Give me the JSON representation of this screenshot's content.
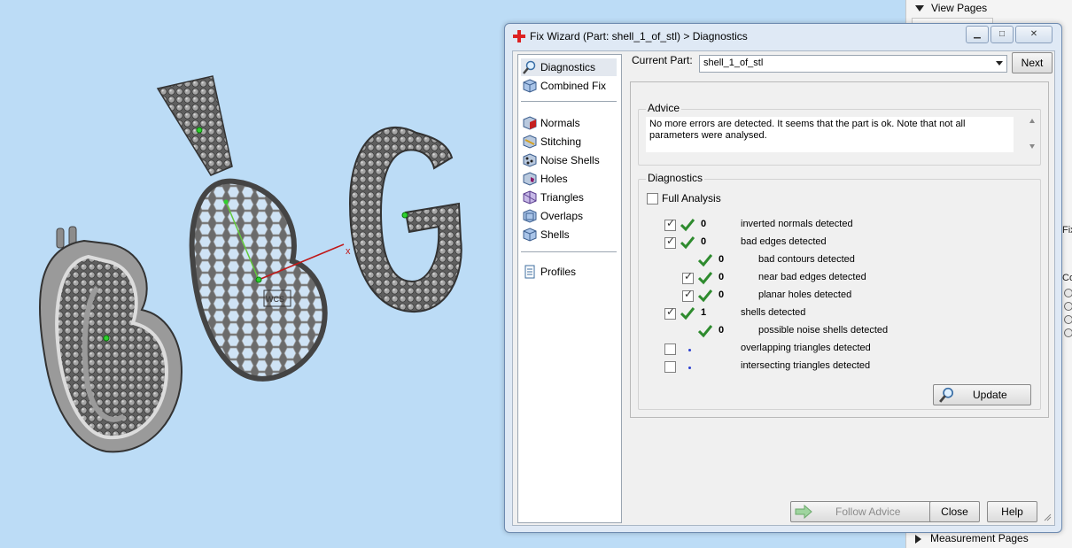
{
  "side_panel": {
    "top_section": "View Pages",
    "bottom_section": "Measurement Pages",
    "cut_labels": [
      "Fix",
      "Co"
    ]
  },
  "viewport": {
    "axis_label": "x",
    "origin_label": "WCS"
  },
  "dialog": {
    "title": "Fix Wizard (Part: shell_1_of_stl) > Diagnostics",
    "nav": {
      "items": [
        {
          "label": "Diagnostics",
          "icon": "magnifier-icon"
        },
        {
          "label": "Combined Fix",
          "icon": "cube-icon"
        },
        {
          "label": "Normals",
          "icon": "normals-icon"
        },
        {
          "label": "Stitching",
          "icon": "stitching-icon"
        },
        {
          "label": "Noise Shells",
          "icon": "noise-shells-icon"
        },
        {
          "label": "Holes",
          "icon": "holes-icon"
        },
        {
          "label": "Triangles",
          "icon": "triangles-icon"
        },
        {
          "label": "Overlaps",
          "icon": "overlaps-icon"
        },
        {
          "label": "Shells",
          "icon": "shells-icon"
        },
        {
          "label": "Profiles",
          "icon": "profiles-icon"
        }
      ]
    },
    "current_part": {
      "label": "Current Part:",
      "value": "shell_1_of_stl"
    },
    "next_label": "Next",
    "advice": {
      "title": "Advice",
      "text": "No more errors are detected. It seems that the part is ok. Note that not all parameters were analysed."
    },
    "diagnostics": {
      "title": "Diagnostics",
      "full_analysis_label": "Full Analysis",
      "rows": [
        {
          "checked": true,
          "status": "ok",
          "count": "0",
          "text": "inverted normals detected"
        },
        {
          "checked": true,
          "status": "ok",
          "count": "0",
          "text": "bad edges detected"
        },
        {
          "checked": null,
          "status": "ok",
          "count": "0",
          "text": "bad contours detected"
        },
        {
          "checked": true,
          "status": "ok",
          "count": "0",
          "text": "near bad edges detected"
        },
        {
          "checked": true,
          "status": "ok",
          "count": "0",
          "text": "planar holes detected"
        },
        {
          "checked": true,
          "status": "ok",
          "count": "1",
          "text": "shells detected"
        },
        {
          "checked": null,
          "status": "ok",
          "count": "0",
          "text": "possible noise shells detected"
        },
        {
          "checked": false,
          "status": "pending",
          "count": "",
          "text": "overlapping triangles detected"
        },
        {
          "checked": false,
          "status": "pending",
          "count": "",
          "text": "intersecting triangles detected"
        }
      ]
    },
    "update_label": "Update",
    "follow_advice_label": "Follow Advice",
    "close_label": "Close",
    "help_label": "Help"
  },
  "colors": {
    "viewport_bg": "#bcdcf6",
    "check_green": "#2e8b2e",
    "dialog_frame": "#dfe9f5",
    "axis_red": "#c01818",
    "axis_green": "#62c83a"
  }
}
